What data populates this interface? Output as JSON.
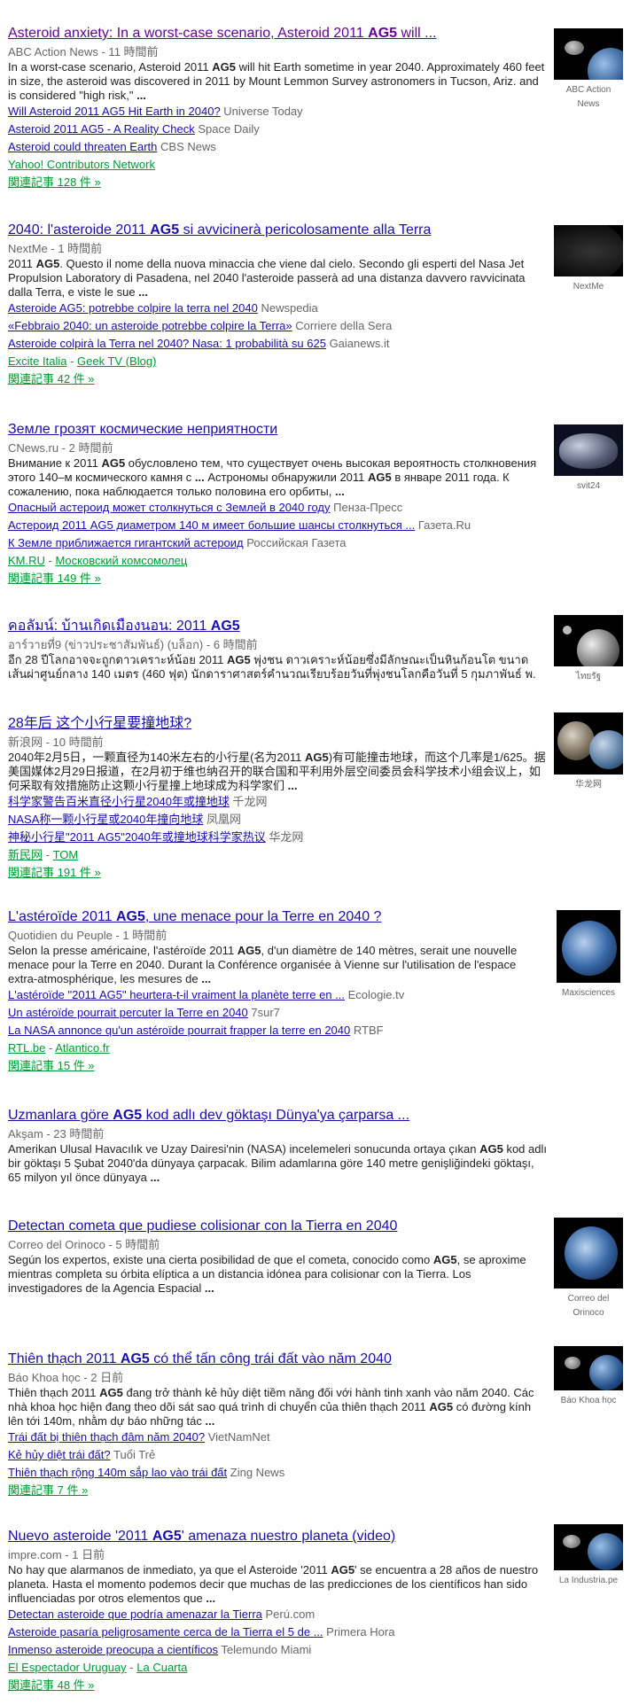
{
  "stories": [
    {
      "title_pre": "Asteroid anxiety: In a worst-case scenario, Asteroid 2011 ",
      "title_bold": "AG5",
      "title_post": " will ...",
      "source": "ABC Action News - 11 時間前",
      "snippet_html": "In a worst-case scenario, Asteroid 2011 <b>AG5</b> will hit Earth sometime in year 2040. Approximately 460 feet in size, the asteroid was discovered in 2011 by Mount Lemmon Survey astronomers in Tucson, Ariz. and is considered \"high risk,\" <b>...</b>",
      "related": [
        {
          "link": "Will Asteroid 2011 AG5 Hit Earth in 2040?",
          "source": "Universe Today"
        },
        {
          "link": "Asteroid 2011 AG5 - A Reality Check",
          "source": "Space Daily"
        },
        {
          "link": "Asteroid could threaten Earth",
          "source": "CBS News"
        }
      ],
      "more_sources": [
        "Yahoo! Contributors Network"
      ],
      "all_articles": "関連記事 128 件 »",
      "thumb_caption": "ABC Action News",
      "thumb_icon": "asteroid-earth-image"
    },
    {
      "title_pre": "2040: l'asteroide 2011 ",
      "title_bold": "AG5",
      "title_post": " si avvicinerà pericolosamente alla Terra",
      "source": "NextMe - 1 時間前",
      "snippet_html": "2011 <b>AG5</b>. Questo il nome della nuova minaccia che viene dal cielo. Secondo gli esperti del Nasa Jet Propulsion Laboratory di Pasadena, nel 2040 l'asteroide passerà ad una distanza davvero ravvicinata dalla Terra, e viste le sue <b>...</b>",
      "related": [
        {
          "link": "Asteroide AG5: potrebbe colpire la terra nel 2040",
          "source": "Newspedia"
        },
        {
          "link": "«Febbraio 2040: un asteroide potrebbe colpire la Terra»",
          "source": "Corriere della Sera"
        },
        {
          "link": "Asteroide colpirà la Terra nel 2040? Nasa: 1 probabilità su 625",
          "source": "Gaianews.it"
        }
      ],
      "more_sources": [
        "Excite Italia",
        "Geek TV (Blog)"
      ],
      "all_articles": "関連記事 42 件 »",
      "thumb_caption": "NextMe",
      "thumb_icon": "dark-planet-image"
    },
    {
      "title_pre": "Земле грозят космические неприятности",
      "title_bold": "",
      "title_post": "",
      "source": "CNews.ru - 2 時間前",
      "snippet_html": "Внимание к 2011 <b>AG5</b> обусловлено тем, что существует очень высокая вероятность столкновения этого 140–м космического камня с <b>...</b> Астрономы обнаружили 2011 <b>AG5</b> в январе 2011 года. К сожалению, пока наблюдается только половина его орбиты, <b>...</b>",
      "related": [
        {
          "link": "Опасный астероид может столкнуться с Землей в 2040 году",
          "source": "Пенза-Пресс"
        },
        {
          "link": "Астероид 2011 AG5 диаметром 140 м имеет большие шансы столкнуться ...",
          "source": "Газета.Ru"
        },
        {
          "link": "К Земле приближается гигантский астероид",
          "source": "Российская Газета"
        }
      ],
      "more_sources": [
        "KM.RU",
        "Московский комсомолец"
      ],
      "all_articles": "関連記事 149 件 »",
      "thumb_caption": "svit24",
      "thumb_icon": "asteroid-image"
    },
    {
      "title_pre": "คอลัมน์: บ้านเกิดเมืองนอน: 2011 ",
      "title_bold": "AG5",
      "title_post": "",
      "source": "อาร์วายที่9 (ข่าวประชาสัมพันธ์) (บล็อก) - 6 時間前",
      "snippet_html": "อีก 28 ปีโลกอาจจะถูกดาวเคราะห์น้อย 2011 <b>AG5</b> พุ่งชน ดาวเคราะห์น้อยซึ่งมีลักษณะเป็นหินก้อนโต ขนาดเส้นผ่าศูนย์กลาง 140 เมตร (460 ฟุต) นักดาราศาสตร์คำนวณเรียบร้อยวันที่พุ่งชนโลกคือวันที่ 5 กุมภาพันธ์ พ.",
      "related": [],
      "more_sources": [],
      "all_articles": "",
      "thumb_caption": "ไทยรัฐ",
      "thumb_icon": "planet-moon-image"
    },
    {
      "title_pre": "28年后 这个小行星要撞地球?",
      "title_bold": "",
      "title_post": "",
      "source": "新浪网 - 10 時間前",
      "snippet_html": "2040年2月5日，一颗直径为140米左右的小行星(名为2011 <b>AG5</b>)有可能撞击地球，而这个几率是1/625。据美国媒体2月29日报道，在2月初于维也纳召开的联合国和平利用外层空间委员会科学技术小组会议上，如何采取有效措施防止这颗小行星撞上地球成为科学家们 <b>...</b>",
      "related": [
        {
          "link": "科学家警告百米直径小行星2040年或撞地球",
          "source": "千龙网"
        },
        {
          "link": "NASA称一颗小行星或2040年撞向地球",
          "source": "凤凰网"
        },
        {
          "link": "神秘小行星\"2011 AG5\"2040年或撞地球科学家热议",
          "source": "华龙网"
        }
      ],
      "more_sources": [
        "新民网",
        "TOM"
      ],
      "all_articles": "関連記事 191 件 »",
      "thumb_caption": "华龙网",
      "thumb_icon": "asteroid-image"
    },
    {
      "title_pre": "L'astéroïde 2011 ",
      "title_bold": "AG5",
      "title_post": ", une menace pour la Terre en 2040 ?",
      "source": "Quotidien du Peuple - 1 時間前",
      "snippet_html": "Selon la presse américaine, l'astéroïde 2011 <b>AG5</b>, d'un diamètre de 140 mètres, serait une nouvelle menace pour la Terre en 2040. Durant la Conférence organisée à Vienne sur l'utilisation de l'espace extra-atmosphérique, les mesures de <b>...</b>",
      "related": [
        {
          "link": "L'astéroïde \"2011 AG5\" heurtera-t-il vraiment la planète terre en ...",
          "source": "Ecologie.tv"
        },
        {
          "link": "Un astéroïde pourrait percuter la Terre en 2040",
          "source": "7sur7"
        },
        {
          "link": "La NASA annonce qu'un astéroïde pourrait frapper la terre en 2040",
          "source": "RTBF"
        }
      ],
      "more_sources": [
        "RTL.be",
        "Atlantico.fr"
      ],
      "all_articles": "関連記事 15 件 »",
      "thumb_caption": "Maxisciences",
      "thumb_icon": "earth-image"
    },
    {
      "title_pre": "Uzmanlara göre ",
      "title_bold": "AG5",
      "title_post": " kod adlı dev göktaşı Dünya'ya çarparsa ...",
      "source": "Akşam - 23 時間前",
      "snippet_html": "Amerikan Ulusal Havacılık ve Uzay Dairesi'nin (NASA) incelemeleri sonucunda ortaya çıkan <b>AG5</b> kod adlı bir göktaşı 5 Şubat 2040'da dünyaya çarpacak. Bilim adamlarına göre 140 metre genişliğindeki göktaşı, 65 milyon yıl önce dünyaya <b>...</b>",
      "related": [],
      "more_sources": [],
      "all_articles": "",
      "thumb_caption": "",
      "thumb_icon": ""
    },
    {
      "title_pre": "Detectan cometa que pudiese colisionar con la Tierra en 2040",
      "title_bold": "",
      "title_post": "",
      "source": "Correo del Orinoco - 5 時間前",
      "snippet_html": "Según los expertos, existe una cierta posibilidad de que el cometa, conocido como <b>AG5</b>, se aproxime mientras completa su órbita elíptica a un distancia idónea para colisionar con la Tierra. Los investigadores de la Agencia Espacial <b>...</b>",
      "related": [],
      "more_sources": [],
      "all_articles": "",
      "thumb_caption": "Correo del Orinoco",
      "thumb_icon": "earth-image"
    },
    {
      "title_pre": "Thiên thạch 2011 ",
      "title_bold": "AG5",
      "title_post": " có thể tấn công trái đất vào năm 2040",
      "source": "Báo Khoa học - 2 日前",
      "snippet_html": "Thiên thạch 2011 <b>AG5</b> đang trở thành kẻ hủy diệt tiềm năng đối với hành tinh xanh vào năm 2040. Các nhà khoa học hiện đang theo dõi sát sao quá trình di chuyển của thiên thạch 2011 <b>AG5</b> có đường kính lên tới 140m, nhằm dự báo những tác <b>...</b>",
      "related": [
        {
          "link": "Trái đất bị thiên thạch đâm năm 2040?",
          "source": "VietNamNet"
        },
        {
          "link": "Kẻ hủy diệt trái đất?",
          "source": "Tuổi Trẻ"
        },
        {
          "link": "Thiên thạch rộng 140m sắp lao vào trái đất",
          "source": "Zing News"
        }
      ],
      "more_sources": [],
      "all_articles": "関連記事 7 件 »",
      "thumb_caption": "Báo Khoa học",
      "thumb_icon": "asteroid-earth-image"
    },
    {
      "title_pre": "Nuevo asteroide '2011 ",
      "title_bold": "AG5",
      "title_post": "' amenaza nuestro planeta (video)",
      "source": "impre.com - 1 日前",
      "snippet_html": "No hay que alarmanos de inmediato, ya que el Asteroide '2011 <b>AG5</b>' se encuentra a 28 años de nuestro planeta. Hasta el momento podemos decir que muchas de las predicciones de los científicos han sido influenciadas por otros elementos que <b>...</b>",
      "related": [
        {
          "link": "Detectan asteroide que podría amenazar la Tierra",
          "source": "Perú.com"
        },
        {
          "link": "Asteroide pasaría peligrosamente cerca de la Tierra el 5 de ...",
          "source": "Primera Hora"
        },
        {
          "link": "Inmenso asteroide preocupa a científicos",
          "source": "Telemundo Miami"
        }
      ],
      "more_sources": [
        "El Espectador Uruguay",
        "La Cuarta"
      ],
      "all_articles": "関連記事 48 件 »",
      "thumb_caption": "La Industria.pe",
      "thumb_icon": "asteroid-earth-image"
    }
  ]
}
